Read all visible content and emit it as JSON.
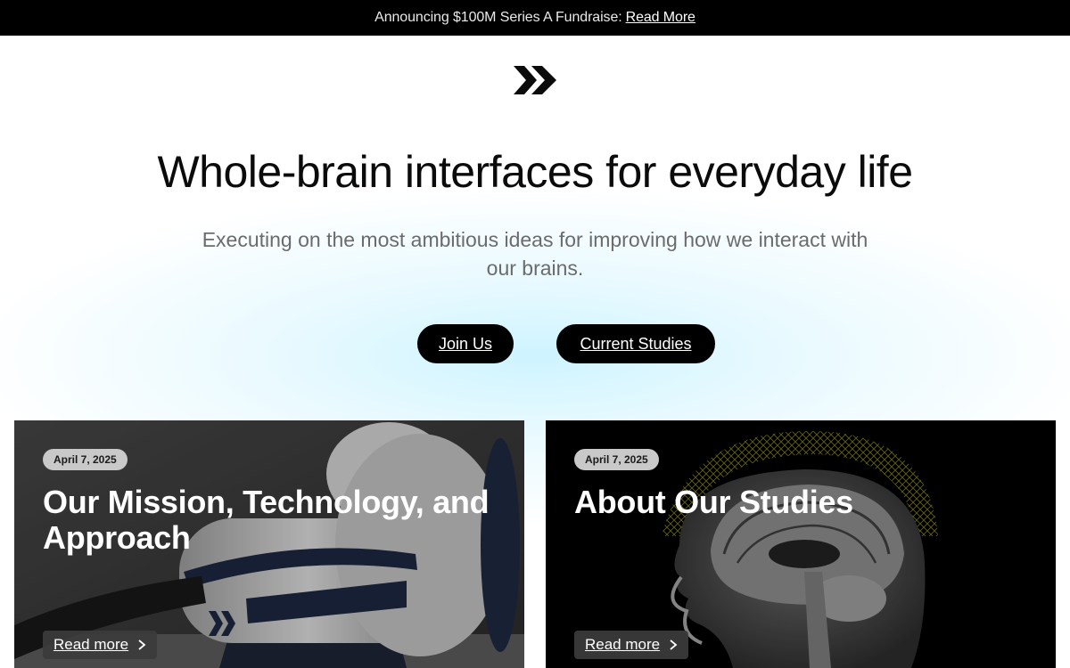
{
  "announcement": {
    "text": "Announcing $100M Series A Fundraise:",
    "link_label": "Read More"
  },
  "hero": {
    "logo_icon": "double-chevron-logo-icon",
    "headline": "Whole-brain interfaces for everyday life",
    "subhead": "Executing on the most ambitious ideas for improving how we interact with our brains.",
    "buttons": [
      {
        "label": "Join Us"
      },
      {
        "label": "Current Studies"
      }
    ]
  },
  "cards": [
    {
      "date": "April 7, 2025",
      "title": "Our Mission, Technology, and Approach",
      "read_more": "Read more",
      "image": "headset-device-photo"
    },
    {
      "date": "April 7, 2025",
      "title": "About Our Studies",
      "read_more": "Read more",
      "image": "brain-mri-scan"
    }
  ],
  "colors": {
    "announcement_bg": "#000000",
    "button_bg": "#000000",
    "hero_glow": "#c6f1ff",
    "date_pill_bg": "#c9c9c9",
    "mri_mesh": "#c8c020"
  }
}
